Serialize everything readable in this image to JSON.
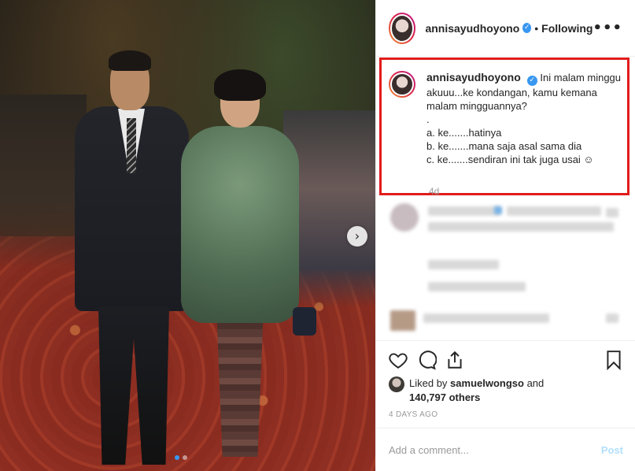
{
  "post": {
    "username": "annisayudhoyono",
    "verified_icon": "verified-badge-icon",
    "separator": "•",
    "follow_status": "Following",
    "more_label": "•••",
    "caption_lines": [
      "Ini malam minggu akuuu...ke kondangan, kamu kemana malam mingguannya?",
      ".",
      "a. ke.......hatinya",
      "b. ke.......mana saja asal sama dia",
      "c. ke.......sendiran ini tak juga usai ☺"
    ],
    "caption_time": "4d",
    "carousel_next_label": "›",
    "carousel_dots": 2,
    "liked_by_prefix": "Liked by ",
    "liked_by_user": "samuelwongso",
    "liked_by_and": " and",
    "liked_by_count": "140,797 others",
    "time_ago": "4 DAYS AGO",
    "comment_placeholder": "Add a comment...",
    "post_label": "Post"
  },
  "icons": {
    "like": "heart-icon",
    "comment": "comment-icon",
    "share": "share-icon",
    "save": "bookmark-icon"
  },
  "colors": {
    "highlight_border": "#e11c1c",
    "verified": "#3897f0",
    "post_button_disabled": "#b2dffc"
  }
}
